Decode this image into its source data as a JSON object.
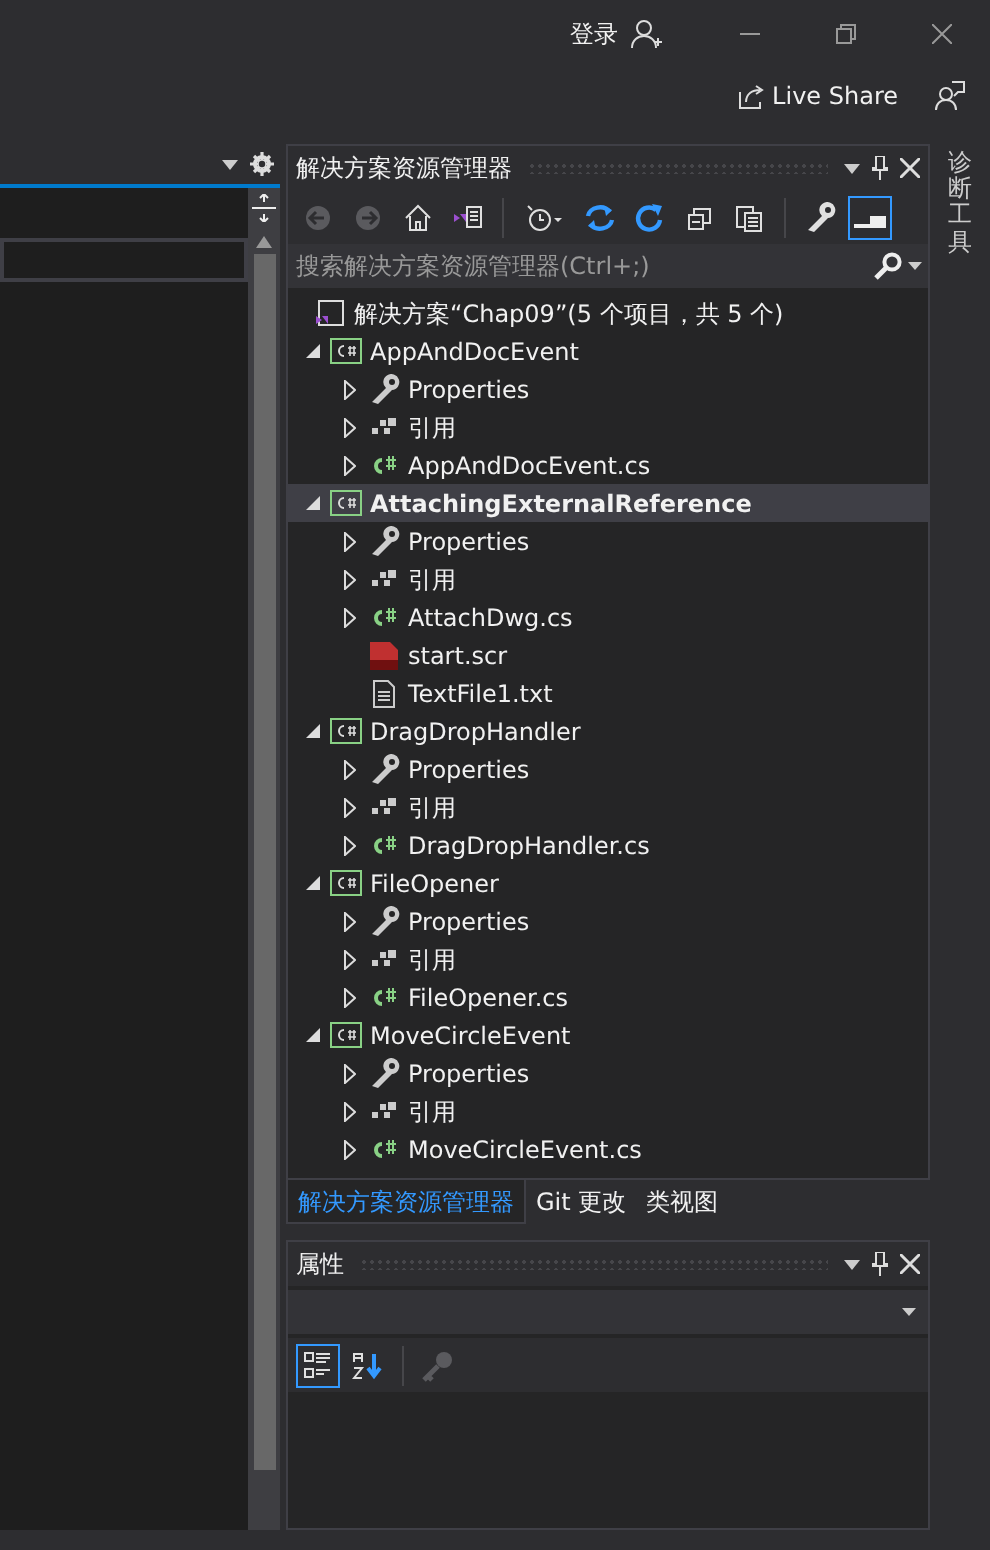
{
  "title_bar": {
    "sign_in": "登录"
  },
  "command_bar": {
    "live_share": "Live Share"
  },
  "solution_explorer": {
    "title": "解决方案资源管理器",
    "toolbar": [
      {
        "kind": "back",
        "disabled": true,
        "pressed": false
      },
      {
        "kind": "forward",
        "disabled": true,
        "pressed": false
      },
      {
        "kind": "home",
        "disabled": false,
        "pressed": false
      },
      {
        "kind": "switch",
        "disabled": false,
        "pressed": false
      },
      {
        "kind": "history",
        "disabled": false,
        "pressed": false
      },
      {
        "kind": "sync",
        "disabled": false,
        "pressed": false
      },
      {
        "kind": "refresh",
        "disabled": false,
        "pressed": false
      },
      {
        "kind": "collapse",
        "disabled": false,
        "pressed": false
      },
      {
        "kind": "showall",
        "disabled": false,
        "pressed": false
      },
      {
        "kind": "properties",
        "disabled": false,
        "pressed": false
      },
      {
        "kind": "preview",
        "disabled": false,
        "pressed": true
      }
    ],
    "search": {
      "placeholder": "搜索解决方案资源管理器(Ctrl+;)"
    },
    "tree": [
      {
        "kind": "solution",
        "label": "解决方案“Chap09”(5 个项目，共 5 个)",
        "selected": false,
        "children": [
          {
            "kind": "project",
            "label": "AppAndDocEvent",
            "expanded": true,
            "startup": false,
            "selected": false,
            "children": [
              {
                "kind": "properties",
                "label": "Properties",
                "expanded": false,
                "selected": false
              },
              {
                "kind": "references",
                "label": "引用",
                "expanded": false,
                "selected": false
              },
              {
                "kind": "csharp",
                "label": "AppAndDocEvent.cs",
                "expanded": false,
                "selected": false
              }
            ]
          },
          {
            "kind": "project",
            "label": "AttachingExternalReference",
            "expanded": true,
            "startup": true,
            "selected": true,
            "children": [
              {
                "kind": "properties",
                "label": "Properties",
                "expanded": false,
                "selected": false
              },
              {
                "kind": "references",
                "label": "引用",
                "expanded": false,
                "selected": false
              },
              {
                "kind": "csharp",
                "label": "AttachDwg.cs",
                "expanded": false,
                "selected": false
              },
              {
                "kind": "script",
                "label": "start.scr",
                "selected": false
              },
              {
                "kind": "text",
                "label": "TextFile1.txt",
                "selected": false
              }
            ]
          },
          {
            "kind": "project",
            "label": "DragDropHandler",
            "expanded": true,
            "startup": false,
            "selected": false,
            "children": [
              {
                "kind": "properties",
                "label": "Properties",
                "expanded": false,
                "selected": false
              },
              {
                "kind": "references",
                "label": "引用",
                "expanded": false,
                "selected": false
              },
              {
                "kind": "csharp",
                "label": "DragDropHandler.cs",
                "expanded": false,
                "selected": false
              }
            ]
          },
          {
            "kind": "project",
            "label": "FileOpener",
            "expanded": true,
            "startup": false,
            "selected": false,
            "children": [
              {
                "kind": "properties",
                "label": "Properties",
                "expanded": false,
                "selected": false
              },
              {
                "kind": "references",
                "label": "引用",
                "expanded": false,
                "selected": false
              },
              {
                "kind": "csharp",
                "label": "FileOpener.cs",
                "expanded": false,
                "selected": false
              }
            ]
          },
          {
            "kind": "project",
            "label": "MoveCircleEvent",
            "expanded": true,
            "startup": false,
            "selected": false,
            "children": [
              {
                "kind": "properties",
                "label": "Properties",
                "expanded": false,
                "selected": false
              },
              {
                "kind": "references",
                "label": "引用",
                "expanded": false,
                "selected": false
              },
              {
                "kind": "csharp",
                "label": "MoveCircleEvent.cs",
                "expanded": false,
                "selected": false
              }
            ]
          }
        ]
      }
    ]
  },
  "tabs": [
    {
      "label": "解决方案资源管理器",
      "selected": true
    },
    {
      "label": "Git 更改",
      "selected": false
    },
    {
      "label": "类视图",
      "selected": false
    }
  ],
  "properties": {
    "title": "属性",
    "toolbar": [
      {
        "kind": "categorized",
        "disabled": false,
        "pressed": true
      },
      {
        "kind": "alphabetical",
        "disabled": false,
        "pressed": false
      },
      {
        "kind": "pages",
        "disabled": true,
        "pressed": false
      }
    ]
  },
  "side_strip": {
    "label": "诊断工具"
  }
}
